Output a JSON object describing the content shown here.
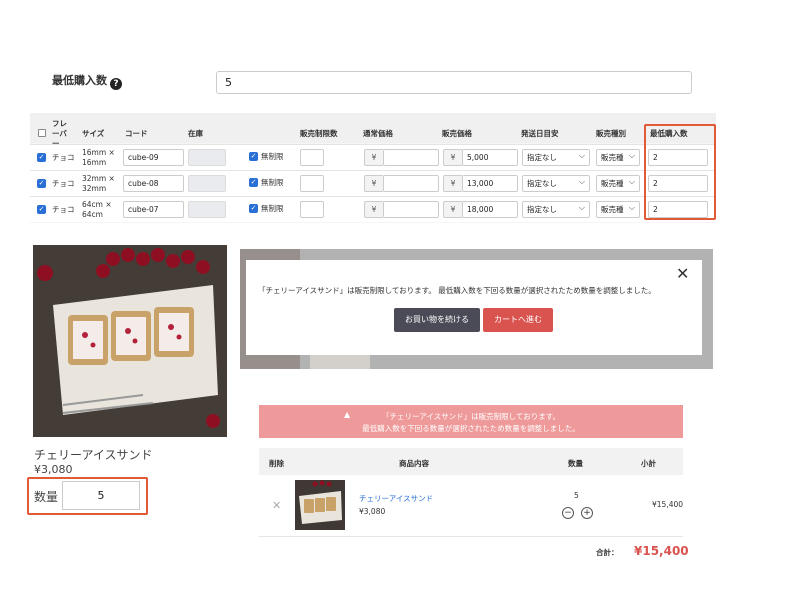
{
  "min_purchase": {
    "label": "最低購入数",
    "value": "5"
  },
  "variants": {
    "headers": {
      "flavor": "フレーバー",
      "size": "サイズ",
      "code": "コード",
      "stock": "在庫",
      "sales_limit": "販売制限数",
      "regular_price": "通常価格",
      "sale_price": "販売価格",
      "ship_date": "発送日目安",
      "sale_type": "販売種別",
      "min_qty": "最低購入数"
    },
    "rows": [
      {
        "flavor": "チョコ",
        "size": "16mm × 16mm",
        "code": "cube-09",
        "unlimited": "無制限",
        "yen": "¥",
        "price": "5,000",
        "ship": "指定なし",
        "type": "販売種",
        "min": "2"
      },
      {
        "flavor": "チョコ",
        "size": "32mm × 32mm",
        "code": "cube-08",
        "unlimited": "無制限",
        "yen": "¥",
        "price": "13,000",
        "ship": "指定なし",
        "type": "販売種",
        "min": "2"
      },
      {
        "flavor": "チョコ",
        "size": "64cm × 64cm",
        "code": "cube-07",
        "unlimited": "無制限",
        "yen": "¥",
        "price": "18,000",
        "ship": "指定なし",
        "type": "販売種",
        "min": "2"
      }
    ]
  },
  "product": {
    "name": "チェリーアイスサンド",
    "price": "¥3,080",
    "qty_label": "数量",
    "qty_value": "5"
  },
  "modal": {
    "message": "「チェリーアイスサンド」は販売制限しております。 最低購入数を下回る数量が選択されたため数量を調整しました。",
    "continue_label": "お買い物を続ける",
    "cart_label": "カートへ進む"
  },
  "alert": {
    "line1": "「チェリーアイスサンド」は販売制限しております。",
    "line2": "最低購入数を下回る数量が選択されたため数量を調整しました。"
  },
  "cart": {
    "headers": {
      "delete": "削除",
      "product": "商品内容",
      "qty": "数量",
      "subtotal": "小計"
    },
    "item": {
      "name": "チェリーアイスサンド",
      "price": "¥3,080",
      "qty": "5",
      "subtotal": "¥15,400"
    },
    "total_label": "合計：",
    "total_value": "¥15,400"
  },
  "colors": {
    "accent_red": "#e05a3a",
    "checkbox_blue": "#2a6fd6",
    "alert_pink": "#ef9a9a",
    "cart_red": "#d9534f"
  }
}
